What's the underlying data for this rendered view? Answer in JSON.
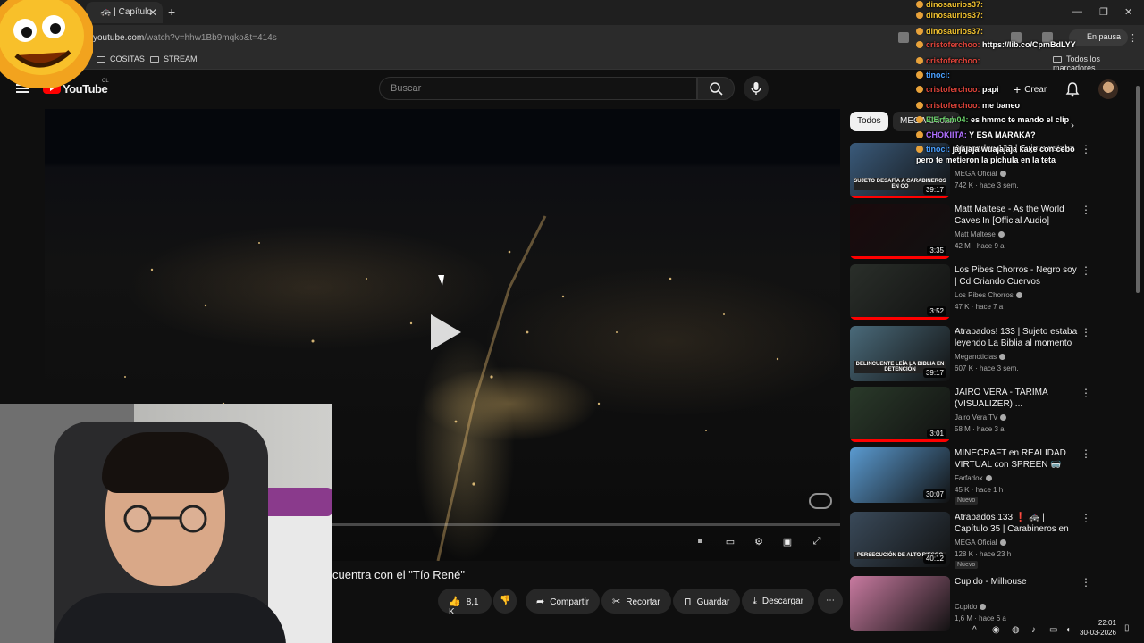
{
  "browser": {
    "tab_title": "🚓 | Capítulo",
    "url_host": "youtube.com",
    "url_path": "/watch?v=hhw1Bb9mqko&t=414s",
    "pause_label": "En pausa",
    "bookmarks": [
      "COSITAS",
      "STREAM"
    ],
    "bookmarks_all": "Todos los marcadores"
  },
  "youtube": {
    "logo_text": "YouTube",
    "region": "CL",
    "search_placeholder": "Buscar",
    "create_label": "Crear"
  },
  "player": {
    "progress_fraction": 0.19,
    "title_fragment": "cuentra con el \"Tío René\""
  },
  "actions": {
    "likes": "8,1 K",
    "share": "Compartir",
    "clip": "Recortar",
    "save": "Guardar",
    "download": "Descargar"
  },
  "chips": [
    "Todos",
    "MEGA Oficial"
  ],
  "recommendations": [
    {
      "title": "Atrapados 133 | Sujeto estaba",
      "channel": "MEGA Oficial",
      "meta": "742 K · hace 3 sem.",
      "duration": "39:17",
      "thumb_caption": "SUJETO DESAFÍA A CARABINEROS EN CO",
      "thumb_color": "#3a5a7a",
      "watched": 1.0,
      "new": ""
    },
    {
      "title": "Matt Maltese - As the World Caves In [Official Audio]",
      "channel": "Matt Maltese",
      "meta": "42 M · hace 9 a",
      "duration": "3:35",
      "thumb_caption": "",
      "thumb_color": "#1a0a0c",
      "watched": 1.0,
      "new": ""
    },
    {
      "title": "Los Pibes Chorros - Negro soy | Cd Criando Cuervos",
      "channel": "Los Pibes Chorros",
      "meta": "47 K · hace 7 a",
      "duration": "3:52",
      "thumb_caption": "",
      "thumb_color": "#2a2f2a",
      "watched": 1.0,
      "new": ""
    },
    {
      "title": "Atrapados! 133 | Sujeto estaba leyendo La Biblia al momento ...",
      "channel": "Meganoticias",
      "meta": "607 K · hace 3 sem.",
      "duration": "39:17",
      "thumb_caption": "DELINCUENTE LEÍA LA BIBLIA EN DETENCIÓN",
      "thumb_color": "#4a6a7a",
      "watched": 0.0,
      "new": ""
    },
    {
      "title": "JAIRO VERA - TARIMA (VISUALIZER) ...",
      "channel": "Jairo Vera TV",
      "meta": "58 M · hace 3 a",
      "duration": "3:01",
      "thumb_caption": "",
      "thumb_color": "#2a3a2a",
      "watched": 1.0,
      "new": ""
    },
    {
      "title": "MINECRAFT en REALIDAD VIRTUAL con SPREEN 🥽",
      "channel": "Farfadox",
      "meta": "45 K · hace 1 h",
      "duration": "30:07",
      "thumb_caption": "",
      "thumb_color": "#5a9ad0",
      "watched": 0.0,
      "new": "Nuevo"
    },
    {
      "title": "Atrapados 133 ❗ 🚓 | Capítulo 35 | Carabineros en extrema ...",
      "channel": "MEGA Oficial",
      "meta": "128 K · hace 23 h",
      "duration": "40:12",
      "thumb_caption": "PERSECUCIÓN DE ALTO RIESGO",
      "thumb_color": "#3a4a5a",
      "watched": 0.0,
      "new": "Nuevo"
    },
    {
      "title": "Cupido - Milhouse",
      "channel": "Cupido",
      "meta": "1,6 M · hace 6 a",
      "duration": "",
      "thumb_caption": "",
      "thumb_color": "#c87aa0",
      "watched": 0.0,
      "new": ""
    }
  ],
  "chat": [
    {
      "user": "dinosaurios37:",
      "msg": "",
      "color": "#f2c230"
    },
    {
      "user": "dinosaurios37:",
      "msg": "",
      "color": "#f2c230"
    },
    {
      "user": "dinosaurios37:",
      "msg": "",
      "color": "#f2c230"
    },
    {
      "user": "cristoferchoo:",
      "msg": "https://lib.co/CpmBdLYY",
      "color": "#e0443a"
    },
    {
      "user": "cristoferchoo:",
      "msg": "",
      "color": "#e0443a"
    },
    {
      "user": "tinoci:",
      "msg": "",
      "color": "#4aa0ff"
    },
    {
      "user": "cristoferchoo:",
      "msg": "papi",
      "color": "#e0443a"
    },
    {
      "user": "cristoferchoo:",
      "msg": "me baneo",
      "color": "#e0443a"
    },
    {
      "user": "ElBrfam04:",
      "msg": "es hmmo te mando el clip",
      "color": "#6ad06a"
    },
    {
      "user": "CHOKIITA:",
      "msg": "Y ESA MARAKA?",
      "color": "#b070ff"
    },
    {
      "user": "tinoci:",
      "msg": "jajajaja wuajajaja kake con cebo",
      "color": "#4aa0ff"
    },
    {
      "user": "",
      "msg": "pero te metieron la pichula en la teta",
      "color": "#ffffff"
    }
  ],
  "taskbar": {
    "time": "22:01",
    "date": "30-03-2026"
  }
}
